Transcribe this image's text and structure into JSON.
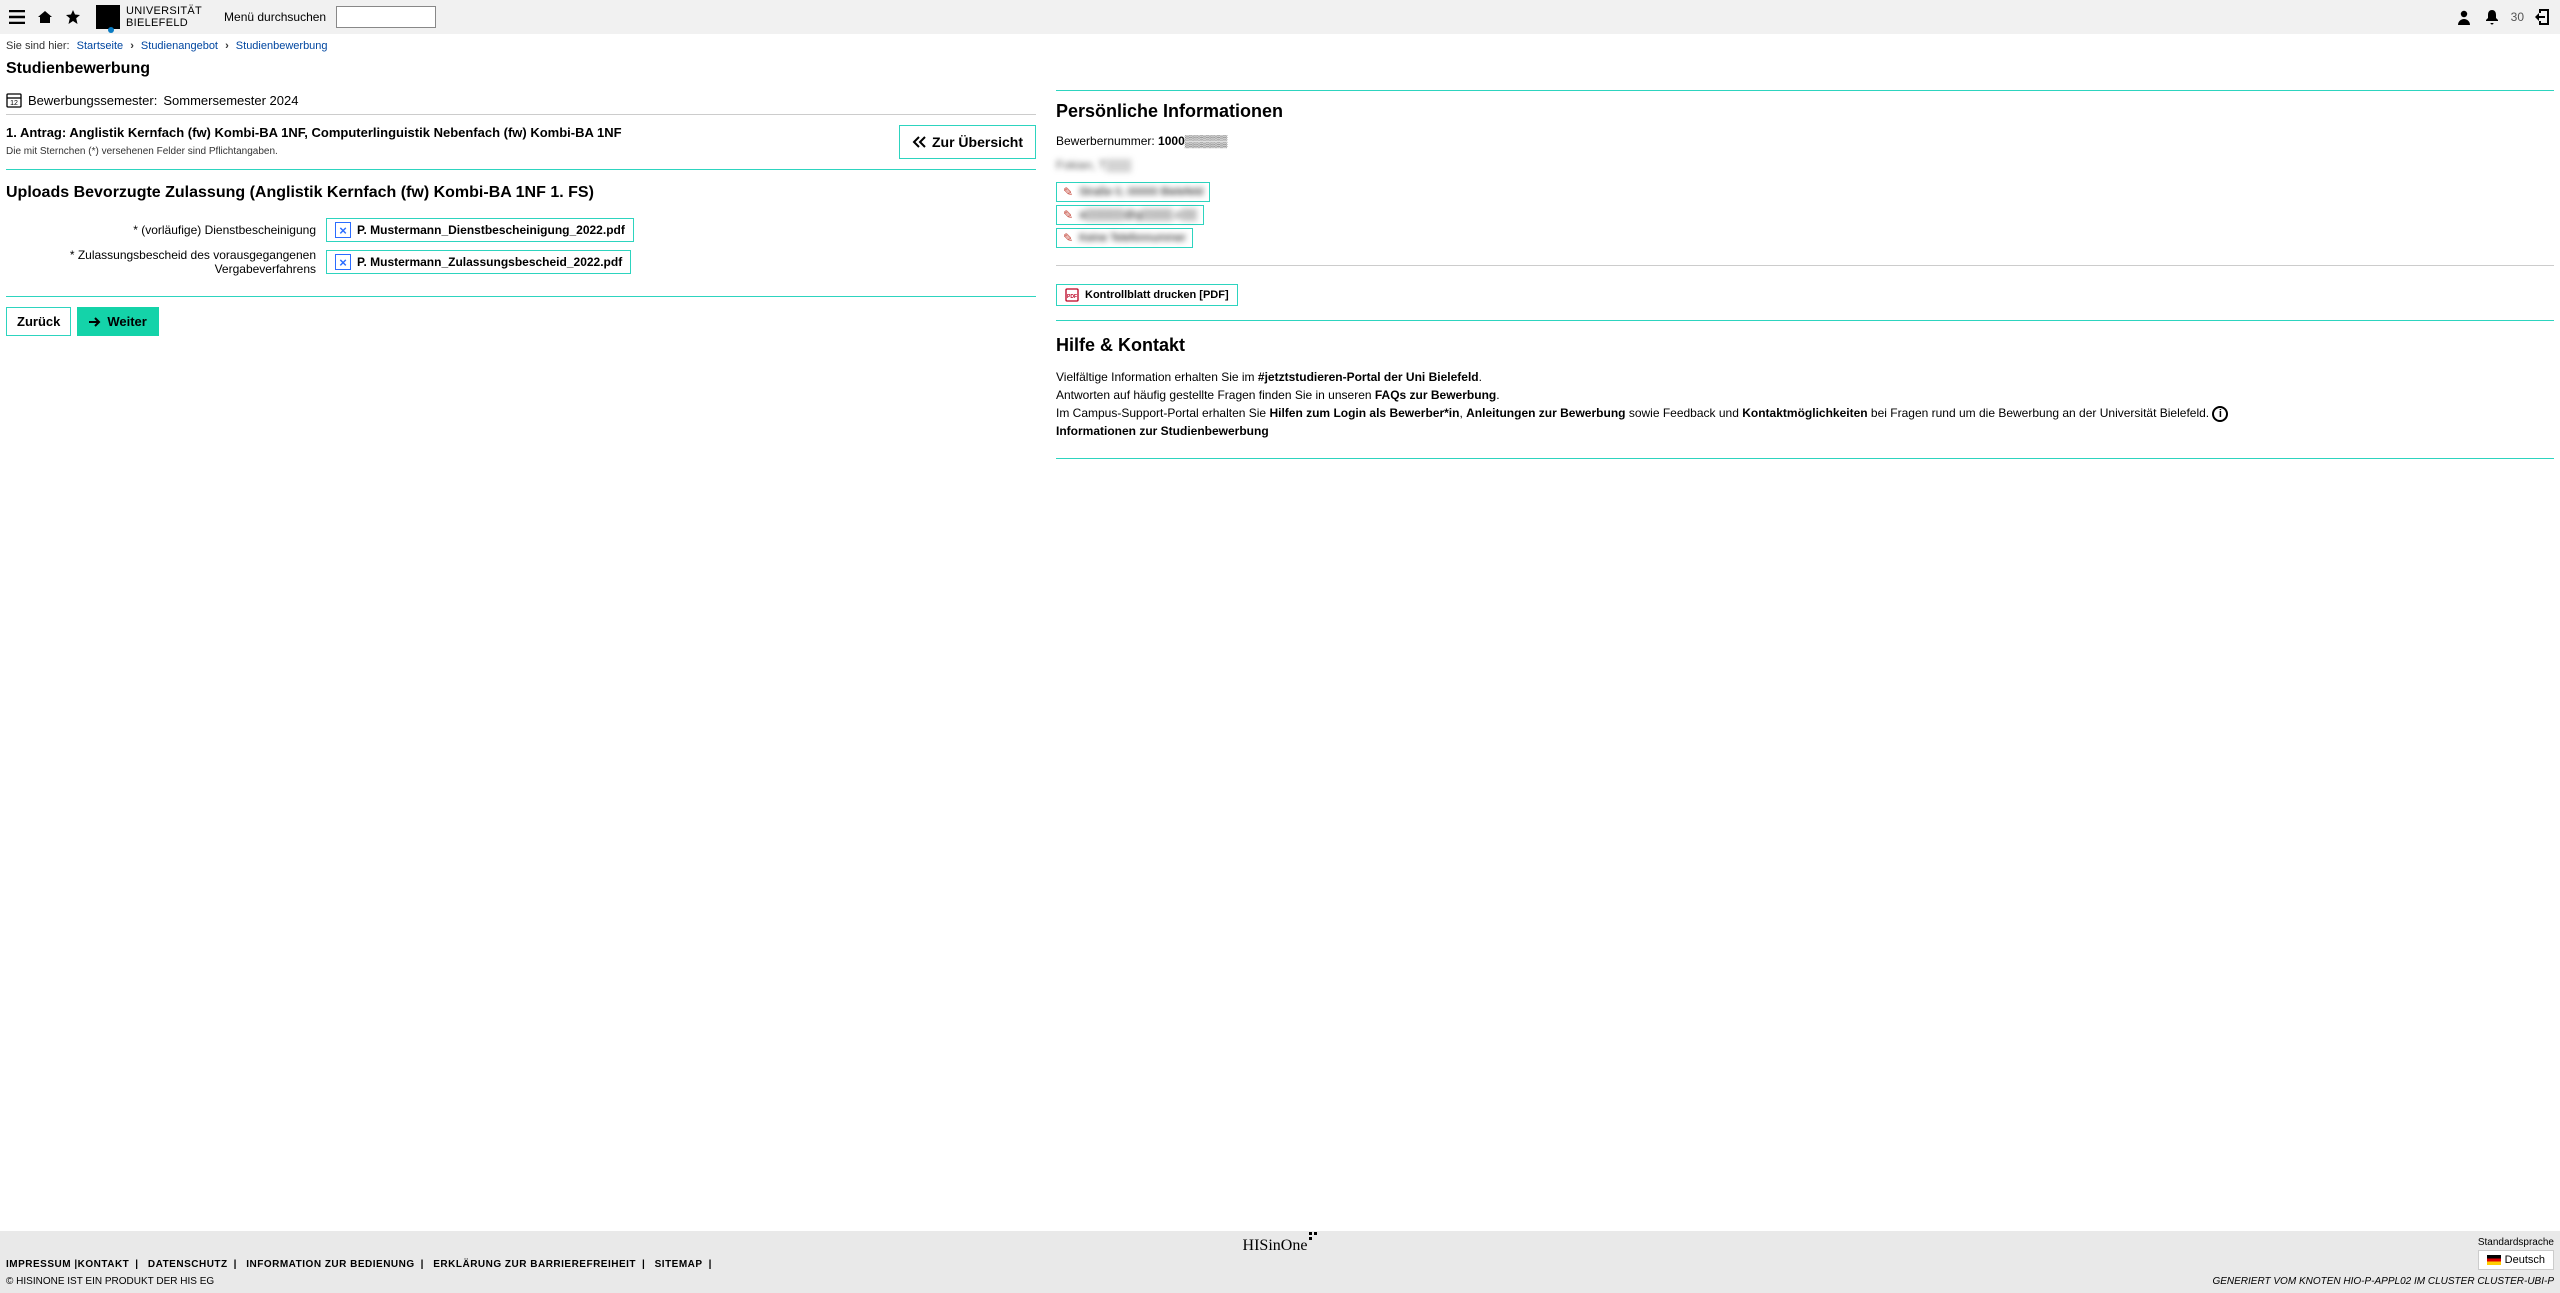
{
  "header": {
    "logo_text_line1": "UNIVERSITÄT",
    "logo_text_line2": "BIELEFELD",
    "search_label": "Menü durchsuchen",
    "search_value": "",
    "notif_count": "30"
  },
  "breadcrumb": {
    "label": "Sie sind hier:",
    "items": [
      "Startseite",
      "Studienangebot",
      "Studienbewerbung"
    ]
  },
  "page_title": "Studienbewerbung",
  "semester": {
    "label": "Bewerbungssemester:",
    "value": "Sommersemester 2024"
  },
  "antrag": {
    "title": "1. Antrag: Anglistik Kernfach (fw) Kombi-BA 1NF, Computerlinguistik Nebenfach (fw) Kombi-BA 1NF",
    "note": "Die mit Sternchen (*) versehenen Felder sind Pflichtangaben.",
    "overview_label": "Zur Übersicht"
  },
  "section_heading": "Uploads Bevorzugte Zulassung (Anglistik Kernfach (fw) Kombi-BA 1NF 1. FS)",
  "uploads": [
    {
      "label": "* (vorläufige) Dienstbescheinigung",
      "file": "P. Mustermann_Dienstbescheinigung_2022.pdf"
    },
    {
      "label": "* Zulassungsbescheid des vorausgegangenen Vergabeverfahrens",
      "file": "P. Mustermann_Zulassungsbescheid_2022.pdf"
    }
  ],
  "nav": {
    "back": "Zurück",
    "next": "Weiter"
  },
  "sidebar": {
    "personal_heading": "Persönliche Informationen",
    "applicant_number_label": "Bewerbernummer:",
    "applicant_number_value": "1000▒▒▒▒▒",
    "name_line": "Fokian, T▒▒▒",
    "pills": [
      "Straße 0, 00000 Bielefeld",
      "a▒▒▒▒▒@g▒▒▒▒.c▒▒",
      "Keine Telefonnummer"
    ],
    "kontrollblatt": "Kontrollblatt drucken [PDF]",
    "help_heading": "Hilfe & Kontakt",
    "help_text1_a": "Vielfältige Information erhalten Sie im ",
    "help_link1": "#jetztstudieren-Portal der Uni Bielefeld",
    "help_text1_b": ".",
    "help_text2_a": "Antworten auf häufig gestellte Fragen finden Sie in unseren ",
    "help_link2": "FAQs zur Bewerbung",
    "help_text2_b": ".",
    "help_text3_a": "Im Campus-Support-Portal erhalten Sie ",
    "help_link3a": "Hilfen zum Login als Bewerber*in",
    "help_text3_b": ", ",
    "help_link3b": "Anleitungen zur Bewerbung",
    "help_text3_c": " so­wie Feedback und ",
    "help_link3c": "Kontaktmöglichkeiten",
    "help_text3_d": " bei Fragen rund um die Bewerbung an der Universität Bielefeld. ",
    "help_link4": "Informationen zur Studienbewerbung"
  },
  "footer": {
    "logo_text": "HISinOne",
    "lang_label": "Standardsprache",
    "lang_value": "Deutsch",
    "links": [
      "IMPRESSUM |KONTAKT",
      "DATENSCHUTZ",
      "INFORMATION ZUR BEDIENUNG",
      "ERKLÄRUNG ZUR BARRIEREFREIHEIT",
      "SITEMAP"
    ],
    "copyright": "© HISINONE IST EIN PRODUKT DER HIS EG",
    "cluster": "GENERIERT VOM KNOTEN HIO-P-APPL02 IM CLUSTER CLUSTER-UBI-P"
  }
}
